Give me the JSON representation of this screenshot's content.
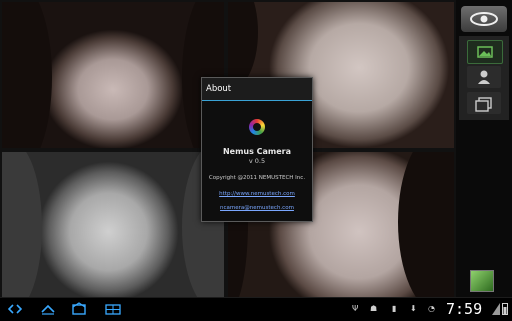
{
  "dialog": {
    "title": "About",
    "app_name": "Nemus Camera",
    "version": "v 0.5",
    "copyright": "Copyright @2011 NEMUSTECH Inc.",
    "website": "http://www.nemustech.com",
    "email": "ncamera@nemustech.com"
  },
  "sidebar": {
    "buttons": [
      {
        "icon": "landscape-icon",
        "active": true
      },
      {
        "icon": "person-icon",
        "active": false
      },
      {
        "icon": "frames-icon",
        "active": false
      }
    ]
  },
  "statusbar": {
    "clock": "7:59",
    "indicators": [
      "usb-icon",
      "android-icon",
      "sd-card-icon",
      "download-icon",
      "wifi-icon",
      "battery-icon"
    ]
  },
  "colors": {
    "accent": "#3aa3d6",
    "nav_icons": "#39a9ff",
    "link": "#7aa7ff"
  }
}
